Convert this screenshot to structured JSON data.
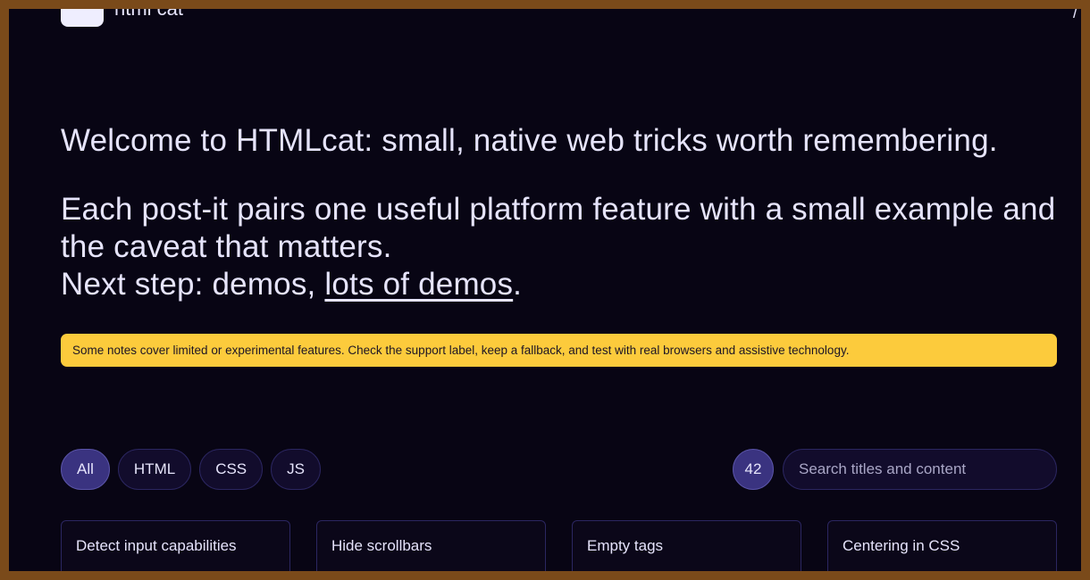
{
  "header": {
    "brand_name": "html cat",
    "corner_mark": "/"
  },
  "hero": {
    "headline": "Welcome to HTMLcat: small, native web tricks worth remembering.",
    "intro_line1": "Each post-it pairs one useful platform feature with a small example and the caveat that matters.",
    "intro_line2_prefix": "Next step: demos, ",
    "intro_link": "lots of demos",
    "intro_line2_suffix": "."
  },
  "notice": {
    "text": "Some notes cover limited or experimental features. Check the support label, keep a fallback, and test with real browsers and assistive technology.",
    "color": "#fccb3c"
  },
  "filters": {
    "items": [
      {
        "label": "All",
        "active": true
      },
      {
        "label": "HTML",
        "active": false
      },
      {
        "label": "CSS",
        "active": false
      },
      {
        "label": "JS",
        "active": false
      }
    ],
    "count": "42",
    "search_placeholder": "Search titles and content"
  },
  "cards": [
    {
      "title": "Detect input capabilities"
    },
    {
      "title": "Hide scrollbars"
    },
    {
      "title": "Empty tags"
    },
    {
      "title": "Centering in CSS"
    }
  ],
  "colors": {
    "background": "#080514",
    "accent": "#3a3380",
    "frame": "#7a4a1a"
  }
}
